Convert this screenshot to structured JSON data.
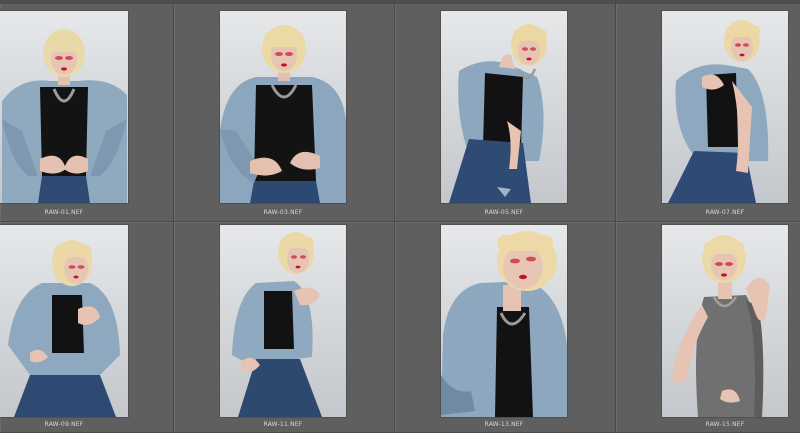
{
  "filmstrip": {
    "thumbnails": [
      {
        "filename": "RAW-01.NEF",
        "pose": "hands-on-hips-open-jacket"
      },
      {
        "filename": "RAW-03.NEF",
        "pose": "hands-on-hips-jacket-off-shoulder"
      },
      {
        "filename": "RAW-05.NEF",
        "pose": "leaning-jacket-held-open"
      },
      {
        "filename": "RAW-07.NEF",
        "pose": "holding-jacket-closed"
      },
      {
        "filename": "RAW-09.NEF",
        "pose": "crouched-holding-collar"
      },
      {
        "filename": "RAW-11.NEF",
        "pose": "crouched-arms-raised"
      },
      {
        "filename": "RAW-13.NEF",
        "pose": "close-up-looking-up"
      },
      {
        "filename": "RAW-15.NEF",
        "pose": "tank-top-arm-raised"
      }
    ]
  },
  "colors": {
    "panel_bg": "#5f5f5f",
    "hair": "#e9d9a8",
    "denim_jacket": "#8ea8bf",
    "top": "#121212",
    "jeans": "#2f4b73",
    "tank": "#707070",
    "skin": "#e6c3b3",
    "lips": "#c0171f"
  }
}
